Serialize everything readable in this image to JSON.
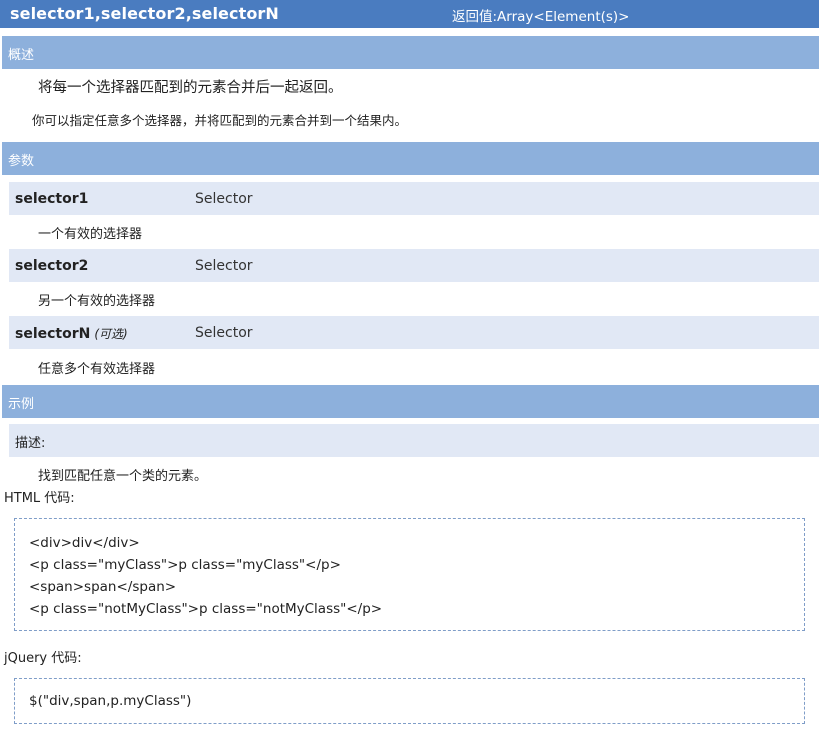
{
  "header": {
    "title": "selector1,selector2,selectorN",
    "return_value": "返回值:Array<Element(s)>"
  },
  "overview": {
    "label": "概述",
    "line1": "将每一个选择器匹配到的元素合并后一起返回。",
    "line2": "你可以指定任意多个选择器，并将匹配到的元素合并到一个结果内。"
  },
  "params": {
    "label": "参数",
    "items": [
      {
        "name": "selector1",
        "optional": "",
        "type": "Selector",
        "desc": "一个有效的选择器"
      },
      {
        "name": "selector2",
        "optional": "",
        "type": "Selector",
        "desc": "另一个有效的选择器"
      },
      {
        "name": "selectorN",
        "optional": "(可选)",
        "type": "Selector",
        "desc": "任意多个有效选择器"
      }
    ]
  },
  "example": {
    "label": "示例",
    "desc_label": "描述:",
    "desc_text": "找到匹配任意一个类的元素。",
    "html_label": "HTML 代码:",
    "html_code": [
      "<div>div</div>",
      "<p class=\"myClass\">p class=\"myClass\"</p>",
      "<span>span</span>",
      "<p class=\"notMyClass\">p class=\"notMyClass\"</p>"
    ],
    "jquery_label": "jQuery 代码:",
    "jquery_code": "$(\"div,span,p.myClass\")"
  },
  "colors": {
    "header_bg": "#4a7cc0",
    "section_bg": "#8db0dc",
    "row_bg": "#e1e8f5",
    "code_border": "#7f9dc8"
  }
}
